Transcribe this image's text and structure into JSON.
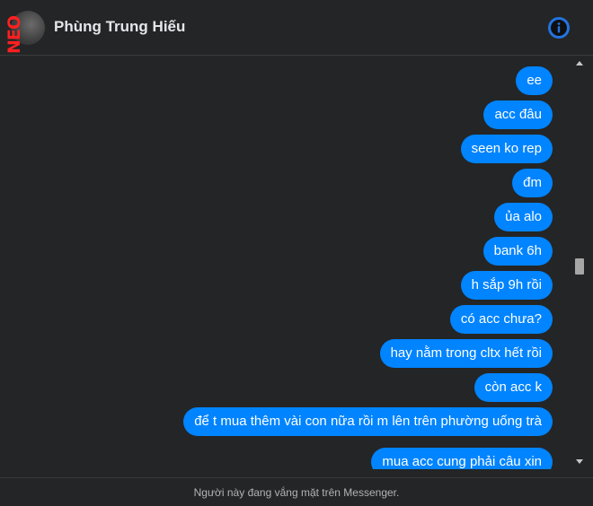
{
  "header": {
    "contact_name": "Phùng Trung Hiếu",
    "avatar_badge": "NEO",
    "info_icon": "info-icon"
  },
  "messages": [
    {
      "text": "ee"
    },
    {
      "text": "acc đâu"
    },
    {
      "text": "seen ko rep"
    },
    {
      "text": "đm"
    },
    {
      "text": "ủa alo"
    },
    {
      "text": "bank 6h"
    },
    {
      "text": "h sắp 9h rồi"
    },
    {
      "text": "có acc chưa?"
    },
    {
      "text": "hay nằm trong cltx hết rồi"
    },
    {
      "text": "còn acc k"
    },
    {
      "text": "để t mua thêm vài con nữa rồi m lên trên phường uống trà"
    },
    {
      "text": "mua acc cung phải câu xin"
    }
  ],
  "footer": {
    "status_text": "Người này đang vắng mặt trên Messenger."
  },
  "colors": {
    "background": "#242526",
    "bubble": "#0084ff",
    "accent": "#2374e1"
  }
}
